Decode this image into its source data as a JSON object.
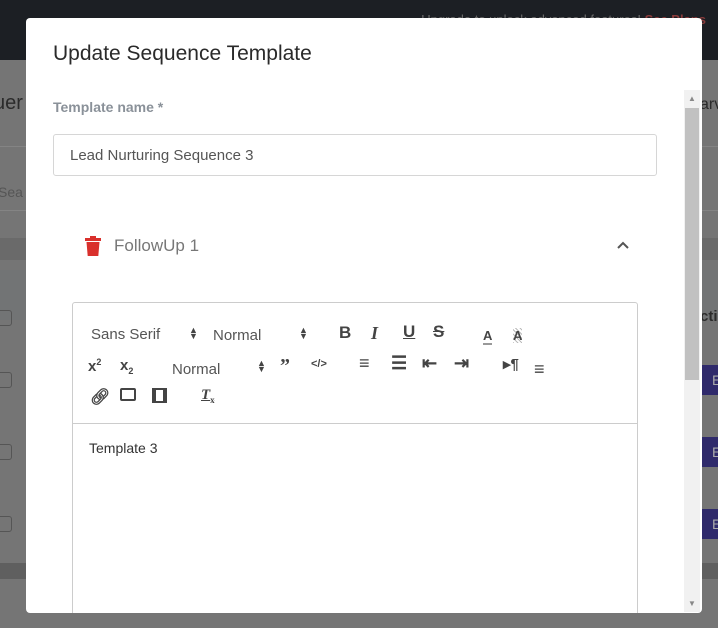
{
  "background": {
    "promo_text": "Upgrade to unlock advanced features!",
    "promo_link": "See Plans",
    "heading_fragment": "uer",
    "right_fragment": "arv",
    "search_fragment": "Sea",
    "column_fragment": "cti",
    "button_fragment": "E"
  },
  "modal": {
    "title": "Update Sequence Template",
    "template_name_label": "Template name *",
    "template_name_value": "Lead Nurturing Sequence 3",
    "followup": {
      "label": "FollowUp 1",
      "expanded": true
    },
    "editor": {
      "font_select": "Sans Serif",
      "size_select": "Normal",
      "heading_select": "Normal",
      "content": "Template 3",
      "tools": [
        "bold",
        "italic",
        "underline",
        "strike",
        "color",
        "background",
        "superscript",
        "subscript",
        "blockquote",
        "code",
        "ordered-list",
        "bullet-list",
        "outdent",
        "indent",
        "direction",
        "align",
        "link",
        "image",
        "video",
        "clean"
      ]
    }
  },
  "colors": {
    "delete": "#d9302c",
    "topbar": "#1c1f24",
    "bg_button": "#2f2a6b"
  }
}
